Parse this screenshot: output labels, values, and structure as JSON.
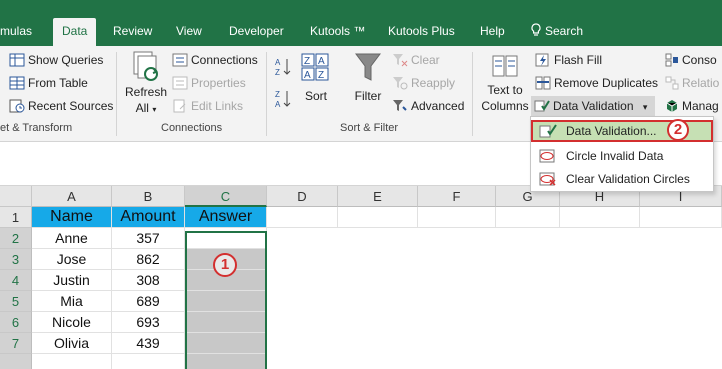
{
  "tabs": [
    "mulas",
    "Data",
    "Review",
    "View",
    "Developer",
    "Kutools ™",
    "Kutools Plus",
    "Help",
    "Search"
  ],
  "ribbon": {
    "get_transform": {
      "show_queries": "Show Queries",
      "from_table": "From Table",
      "recent_sources": "Recent Sources",
      "group_label": "et & Transform"
    },
    "connections": {
      "refresh_all_line1": "Refresh",
      "refresh_all_line2": "All",
      "connections": "Connections",
      "properties": "Properties",
      "edit_links": "Edit Links",
      "group_label": "Connections"
    },
    "sort_filter": {
      "sort": "Sort",
      "filter": "Filter",
      "clear": "Clear",
      "reapply": "Reapply",
      "advanced": "Advanced",
      "group_label": "Sort & Filter"
    },
    "data_tools": {
      "text_to_columns_line1": "Text to",
      "text_to_columns_line2": "Columns",
      "flash_fill": "Flash Fill",
      "remove_duplicates": "Remove Duplicates",
      "data_validation": "Data Validation",
      "consolidate": "Conso",
      "relationships": "Relatio",
      "manage": "Manag"
    }
  },
  "menu": {
    "items": [
      "Data Validation...",
      "Circle Invalid Data",
      "Clear Validation Circles"
    ]
  },
  "callouts": {
    "step1": "1",
    "step2": "2"
  },
  "sheet": {
    "columns": [
      "A",
      "B",
      "C",
      "D",
      "E",
      "F",
      "G",
      "H",
      "I"
    ],
    "rows": [
      "1",
      "2",
      "3",
      "4",
      "5",
      "6",
      "7"
    ],
    "headers": [
      "Name",
      "Amount",
      "Answer"
    ],
    "data": [
      [
        "Anne",
        "357"
      ],
      [
        "Jose",
        "862"
      ],
      [
        "Justin",
        "308"
      ],
      [
        "Mia",
        "689"
      ],
      [
        "Nicole",
        "693"
      ],
      [
        "Olivia",
        "439"
      ]
    ]
  },
  "colors": {
    "excel_green": "#217346",
    "header_fill": "#16a9e8",
    "highlight": "#c6e0b4",
    "callout_red": "#d32f2f"
  }
}
